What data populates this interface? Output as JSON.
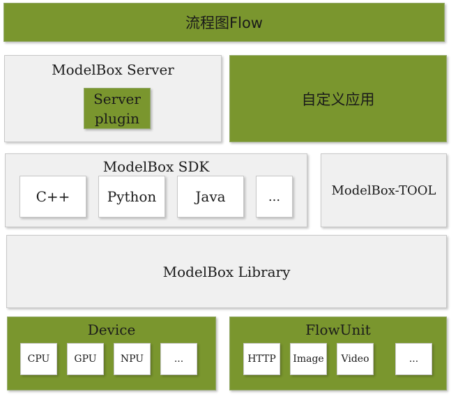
{
  "flow_title": "流程图Flow",
  "server": {
    "title": "ModelBox Server",
    "plugin_line1": "Server",
    "plugin_line2": "plugin"
  },
  "custom_app": "自定义应用",
  "sdk": {
    "title": "ModelBox SDK",
    "languages": [
      "C++",
      "Python",
      "Java",
      "..."
    ]
  },
  "tool": "ModelBox-TOOL",
  "library": "ModelBox Library",
  "device": {
    "title": "Device",
    "items": [
      "CPU",
      "GPU",
      "NPU",
      "..."
    ]
  },
  "flowunit": {
    "title": "FlowUnit",
    "items": [
      "HTTP",
      "Image",
      "Video",
      "..."
    ]
  },
  "colors": {
    "green": "#7a962e",
    "gray": "#f0f0f0",
    "border": "#c7c7c7"
  }
}
